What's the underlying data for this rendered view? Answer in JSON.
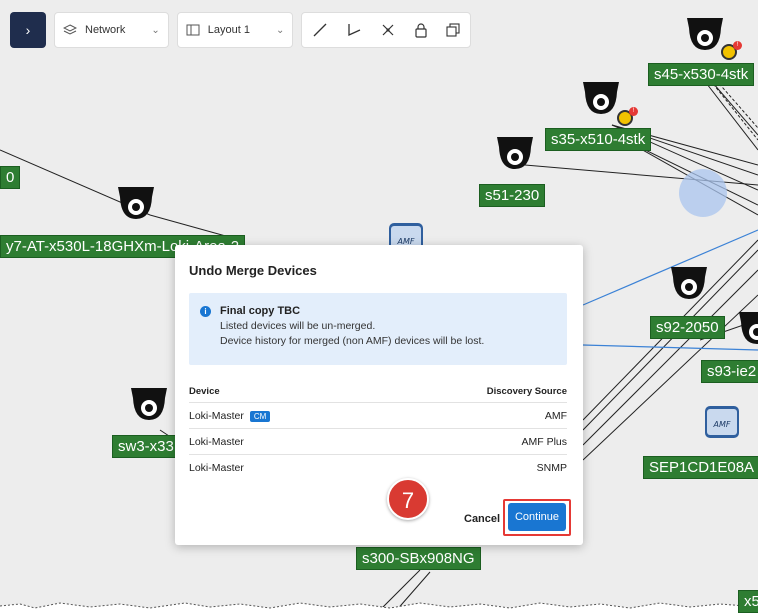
{
  "toolbar": {
    "expand_icon": "chevron-right-icon",
    "view_select": {
      "icon": "layers-icon",
      "value": "Network"
    },
    "layout_select": {
      "icon": "layout-icon",
      "value": "Layout 1"
    },
    "tools": [
      "line-tool-icon",
      "angle-tool-icon",
      "scatter-tool-icon",
      "lock-icon",
      "copy-icon"
    ]
  },
  "map": {
    "labels": {
      "s45": "s45-x530-4stk",
      "s35": "s35-x510-4stk",
      "s51": "s51-230",
      "left_zero": "0",
      "loki_area": "y7-AT-x530L-18GHXm-Loki-Area-2",
      "s92": "s92-2050",
      "s93": "s93-ie2",
      "sw3": "sw3-x33",
      "sep": "SEP1CD1E08A",
      "s300": "s300-SBx908NG",
      "x5": "x5",
      "amf_text": "AMF"
    },
    "colors": {
      "label_green": "#2e7d32",
      "link_line": "#222222",
      "link_blue": "#3b82d6",
      "background": "#ededed"
    }
  },
  "modal": {
    "title": "Undo Merge Devices",
    "info": {
      "icon": "info-icon",
      "title": "Final copy TBC",
      "line1": "Listed devices will be un-merged.",
      "line2": "Device history for merged (non AMF) devices will be lost."
    },
    "table": {
      "headers": {
        "device": "Device",
        "source": "Discovery Source"
      },
      "rows": [
        {
          "device": "Loki-Master",
          "badge": "CM",
          "source": "AMF"
        },
        {
          "device": "Loki-Master",
          "badge": "",
          "source": "AMF Plus"
        },
        {
          "device": "Loki-Master",
          "badge": "",
          "source": "SNMP"
        }
      ]
    },
    "step_number": "7",
    "cancel_label": "Cancel",
    "continue_label": "Continue",
    "colors": {
      "primary": "#1976d2",
      "info_bg": "#e3eefb",
      "highlight": "#e53935",
      "step": "#d93a32"
    }
  }
}
